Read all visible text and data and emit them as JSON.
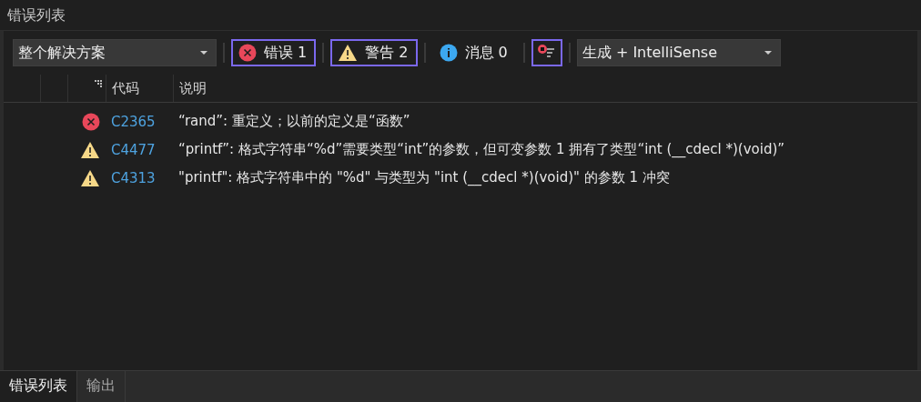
{
  "panel": {
    "title": "错误列表"
  },
  "toolbar": {
    "scope": "整个解决方案",
    "filters": [
      {
        "kind": "error",
        "label": "错误 1",
        "selected": true
      },
      {
        "kind": "warning",
        "label": "警告 2",
        "selected": true
      },
      {
        "kind": "info",
        "label": "消息 0",
        "selected": false
      }
    ],
    "filter_toggle": {
      "selected": true
    },
    "source": "生成 + IntelliSense"
  },
  "table": {
    "columns": [
      "代码",
      "说明"
    ],
    "rows": [
      {
        "kind": "error",
        "code": "C2365",
        "description": "“rand”: 重定义；以前的定义是“函数”"
      },
      {
        "kind": "warning",
        "code": "C4477",
        "description": "“printf”: 格式字符串“%d”需要类型“int”的参数，但可变参数 1 拥有了类型“int (__cdecl *)(void)”"
      },
      {
        "kind": "warning",
        "code": "C4313",
        "description": " \"printf\": 格式字符串中的 \"%d\" 与类型为 \"int (__cdecl *)(void)\" 的参数 1 冲突"
      }
    ]
  },
  "bottom_tabs": [
    {
      "label": "错误列表",
      "selected": true
    },
    {
      "label": "输出",
      "selected": false
    }
  ]
}
